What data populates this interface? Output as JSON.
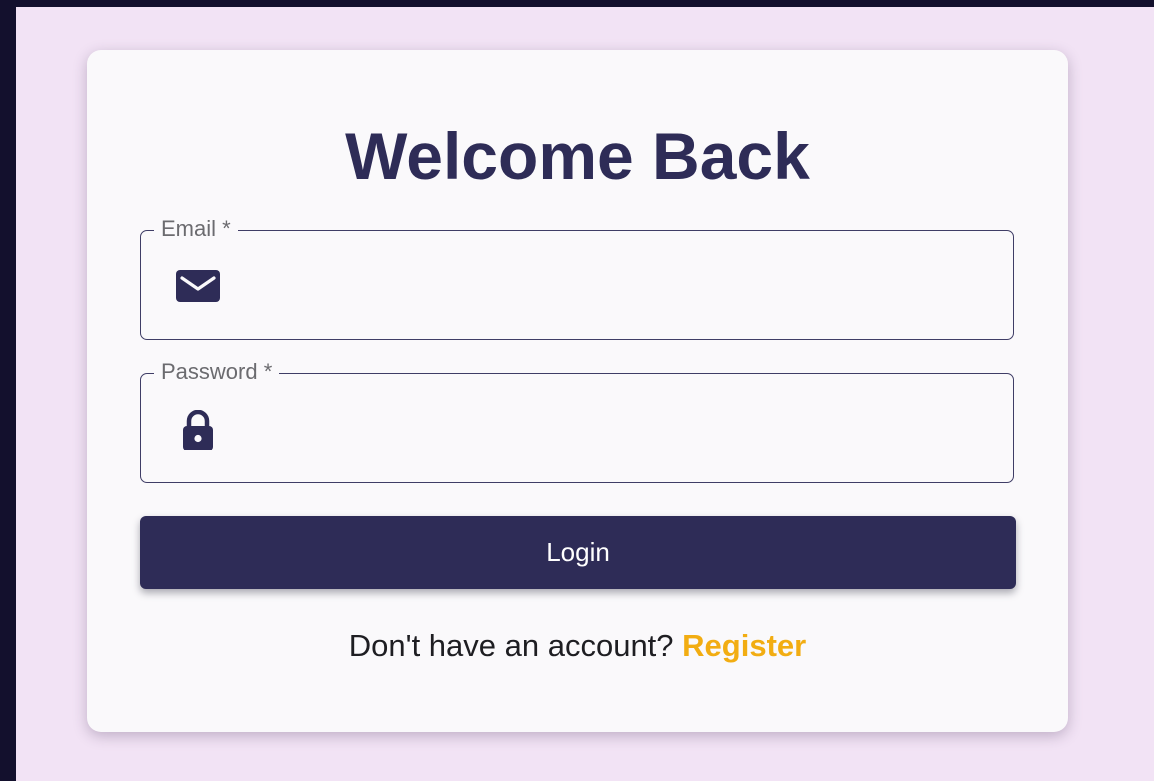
{
  "login_form": {
    "title": "Welcome Back",
    "email": {
      "label": "Email *",
      "value": "",
      "placeholder": "",
      "icon": "mail-icon"
    },
    "password": {
      "label": "Password *",
      "value": "",
      "placeholder": "",
      "icon": "lock-icon"
    },
    "login_label": "Login",
    "footer_text": "Don't have an account?",
    "register_label": "Register"
  },
  "colors": {
    "page_background": "#13102d",
    "stage_background": "#f2e3f5",
    "card_background": "#faf9fb",
    "primary": "#2e2c57",
    "accent": "#f2ad12"
  }
}
